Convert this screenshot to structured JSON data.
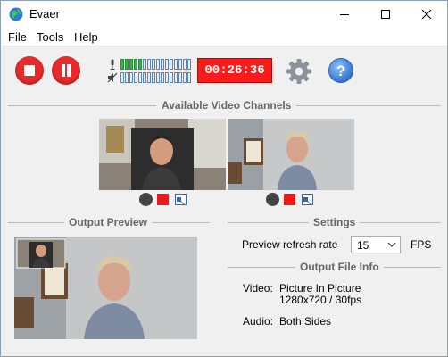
{
  "window": {
    "title": "Evaer"
  },
  "menu": {
    "file": "File",
    "tools": "Tools",
    "help": "Help"
  },
  "toolbar": {
    "timer": "00:26:36",
    "meter_mic_level": 0.3,
    "meter_speaker_level": 0.0
  },
  "sections": {
    "channels": "Available Video Channels",
    "preview": "Output Preview",
    "settings": "Settings",
    "output_info": "Output File Info"
  },
  "settings": {
    "refresh_label": "Preview refresh rate",
    "refresh_value": "15",
    "fps_label": "FPS"
  },
  "output": {
    "video_label": "Video:",
    "video_mode": "Picture In Picture",
    "video_spec": "1280x720 / 30fps",
    "audio_label": "Audio:",
    "audio_mode": "Both Sides"
  },
  "colors": {
    "accent_red": "#e62b2b",
    "timer_bg": "#ff1a1a",
    "help_blue": "#3b7fd6",
    "meter_on": "#37b34a"
  },
  "icons": [
    "evaer-app-icon",
    "minimize-icon",
    "maximize-icon",
    "close-icon",
    "stop-icon",
    "pause-icon",
    "microphone-icon",
    "speaker-icon",
    "gear-icon",
    "help-icon"
  ]
}
